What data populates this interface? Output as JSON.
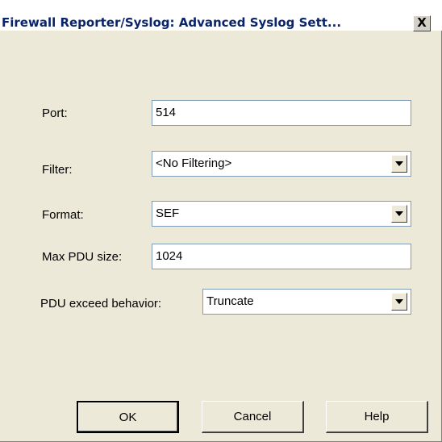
{
  "window": {
    "title": "Firewall Reporter/Syslog: Advanced Syslog Sett...",
    "close_label": "X"
  },
  "form": {
    "port": {
      "label": "Port:",
      "value": "514"
    },
    "filter": {
      "label": "Filter:",
      "value": "<No Filtering>"
    },
    "format": {
      "label": "Format:",
      "value": "SEF"
    },
    "max_pdu": {
      "label": "Max PDU size:",
      "value": "1024"
    },
    "pdu_exceed": {
      "label": "PDU exceed behavior:",
      "value": "Truncate"
    }
  },
  "buttons": {
    "ok": "OK",
    "cancel": "Cancel",
    "help": "Help"
  },
  "icons": {
    "close": "close-icon",
    "dropdown": "chevron-down-icon"
  }
}
